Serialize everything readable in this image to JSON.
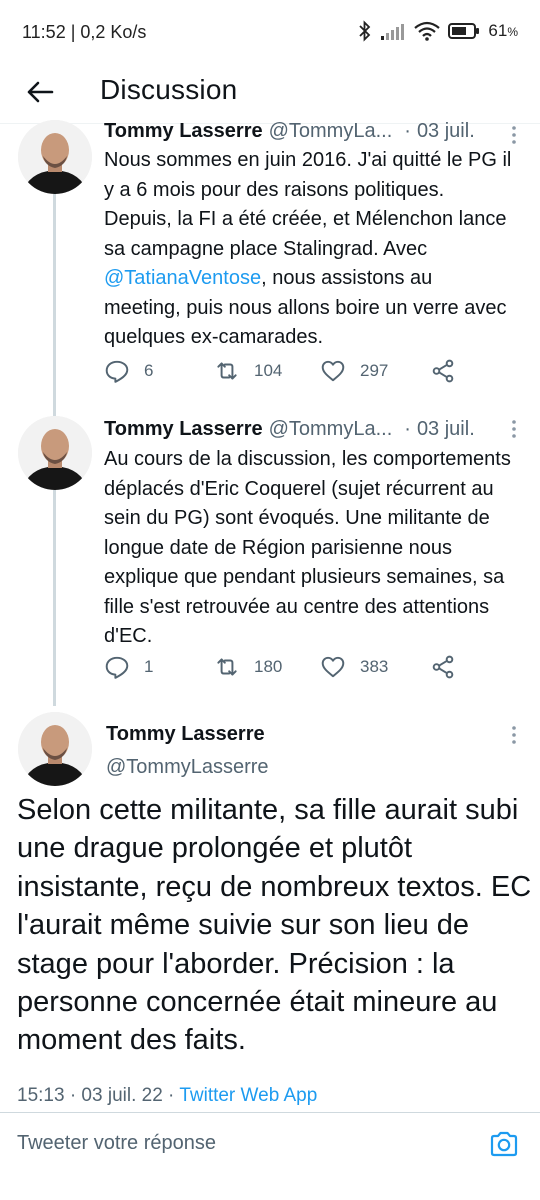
{
  "status_bar": {
    "time_speed": "11:52 | 0,2 Ko/s",
    "battery": "61"
  },
  "header": {
    "title": "Discussion"
  },
  "tweets": [
    {
      "name": "Tommy Lasserre",
      "handle": "@TommyLa...",
      "separator": "·",
      "date": "03 juil.",
      "text_before": "Nous sommes en juin 2016. J'ai quitté le PG il y a 6 mois pour des raisons politiques. Depuis, la FI a été créée, et Mélenchon lance sa campagne place Stalingrad. Avec ",
      "mention": "@TatianaVentose",
      "text_after": ", nous assistons au meeting, puis nous allons boire un verre avec quelques ex-camarades.",
      "replies": "6",
      "retweets": "104",
      "likes": "297"
    },
    {
      "name": "Tommy Lasserre",
      "handle": "@TommyLa...",
      "separator": "·",
      "date": "03 juil.",
      "text": "Au cours de la discussion, les comportements déplacés d'Eric Coquerel (sujet récurrent au sein du PG) sont évoqués. Une militante de longue date de Région parisienne nous explique que pendant plusieurs semaines, sa fille s'est retrouvée au centre des attentions d'EC.",
      "replies": "1",
      "retweets": "180",
      "likes": "383"
    }
  ],
  "main_tweet": {
    "name": "Tommy Lasserre",
    "handle": "@TommyLasserre",
    "text": "Selon cette militante, sa fille aurait subi une drague prolongée et plutôt insistante, reçu de nombreux textos. EC l'aurait même suivie sur son lieu de stage pour l'aborder. Précision : la personne concernée était mineure au moment des faits.",
    "time_date": "15:13 · 03 juil. 22 · ",
    "app": "Twitter Web App"
  },
  "reply_bar": {
    "placeholder": "Tweeter votre réponse"
  },
  "icons": {
    "back": "arrow-left-icon",
    "more": "more-vertical-icon",
    "reply": "reply-icon",
    "retweet": "retweet-icon",
    "like": "heart-icon",
    "share": "share-icon",
    "camera": "camera-icon"
  },
  "colors": {
    "accent": "#1d9bf0",
    "secondary_text": "#536471",
    "thread_line": "#cfd9de"
  }
}
